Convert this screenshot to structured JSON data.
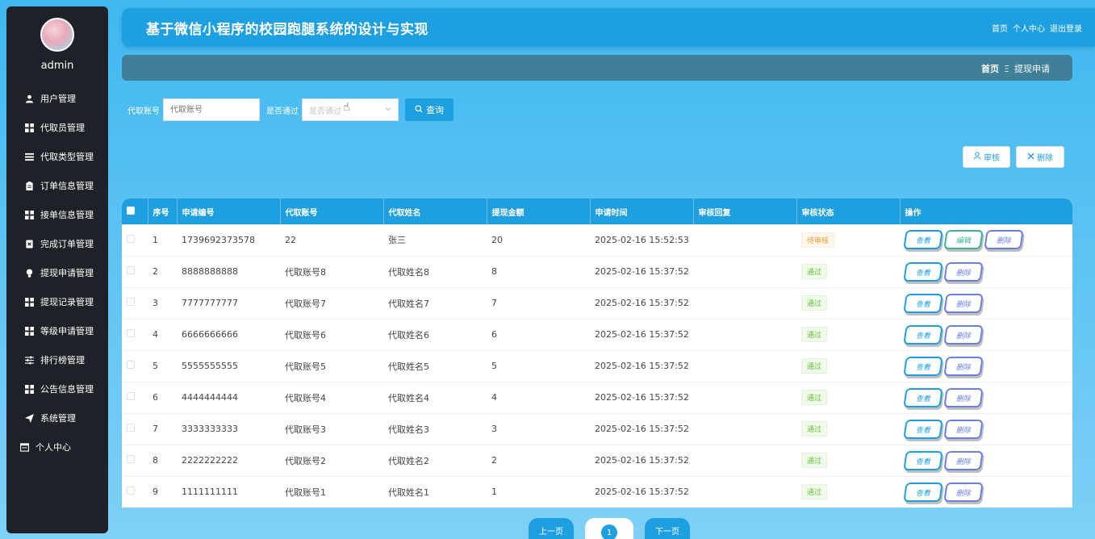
{
  "sidebar": {
    "username": "admin",
    "items": [
      {
        "label": "用户管理",
        "icon": "user-icon"
      },
      {
        "label": "代取员管理",
        "icon": "grid-icon"
      },
      {
        "label": "代取类型管理",
        "icon": "list-icon"
      },
      {
        "label": "订单信息管理",
        "icon": "clipboard-icon"
      },
      {
        "label": "接单信息管理",
        "icon": "grid-icon"
      },
      {
        "label": "完成订单管理",
        "icon": "doc-x-icon"
      },
      {
        "label": "提现申请管理",
        "icon": "bulb-icon"
      },
      {
        "label": "提现记录管理",
        "icon": "grid-icon"
      },
      {
        "label": "等级申请管理",
        "icon": "grid-icon"
      },
      {
        "label": "排行榜管理",
        "icon": "sliders-icon"
      },
      {
        "label": "公告信息管理",
        "icon": "grid-icon"
      },
      {
        "label": "系统管理",
        "icon": "send-icon"
      },
      {
        "label": "个人中心",
        "icon": "window-icon"
      }
    ]
  },
  "header": {
    "title": "基于微信小程序的校园跑腿系统的设计与实现",
    "links": [
      "首页",
      "个人中心",
      "退出登录"
    ]
  },
  "breadcrumb": {
    "home": "首页",
    "separator": "Ξ",
    "current": "提现申请"
  },
  "search": {
    "account_label": "代取账号",
    "account_placeholder": "代取账号",
    "pass_label": "是否通过",
    "pass_placeholder": "是否通过",
    "button_label": "查询"
  },
  "actions": {
    "audit_label": "审核",
    "delete_label": "删除"
  },
  "table": {
    "columns": [
      "序号",
      "申请编号",
      "代取账号",
      "代取姓名",
      "提现金额",
      "申请时间",
      "审核回复",
      "审核状态",
      "操作"
    ],
    "rows": [
      {
        "index": "1",
        "apply_no": "1739692373578",
        "account": "22",
        "name": "张三",
        "amount": "20",
        "time": "2025-02-16 15:52:53",
        "reply": "",
        "status": "待审核",
        "ops": [
          "查看",
          "编辑",
          "删除"
        ]
      },
      {
        "index": "2",
        "apply_no": "8888888888",
        "account": "代取账号8",
        "name": "代取姓名8",
        "amount": "8",
        "time": "2025-02-16 15:37:52",
        "reply": "",
        "status": "通过",
        "ops": [
          "查看",
          "删除"
        ]
      },
      {
        "index": "3",
        "apply_no": "7777777777",
        "account": "代取账号7",
        "name": "代取姓名7",
        "amount": "7",
        "time": "2025-02-16 15:37:52",
        "reply": "",
        "status": "通过",
        "ops": [
          "查看",
          "删除"
        ]
      },
      {
        "index": "4",
        "apply_no": "6666666666",
        "account": "代取账号6",
        "name": "代取姓名6",
        "amount": "6",
        "time": "2025-02-16 15:37:52",
        "reply": "",
        "status": "通过",
        "ops": [
          "查看",
          "删除"
        ]
      },
      {
        "index": "5",
        "apply_no": "5555555555",
        "account": "代取账号5",
        "name": "代取姓名5",
        "amount": "5",
        "time": "2025-02-16 15:37:52",
        "reply": "",
        "status": "通过",
        "ops": [
          "查看",
          "删除"
        ]
      },
      {
        "index": "6",
        "apply_no": "4444444444",
        "account": "代取账号4",
        "name": "代取姓名4",
        "amount": "4",
        "time": "2025-02-16 15:37:52",
        "reply": "",
        "status": "通过",
        "ops": [
          "查看",
          "删除"
        ]
      },
      {
        "index": "7",
        "apply_no": "3333333333",
        "account": "代取账号3",
        "name": "代取姓名3",
        "amount": "3",
        "time": "2025-02-16 15:37:52",
        "reply": "",
        "status": "通过",
        "ops": [
          "查看",
          "删除"
        ]
      },
      {
        "index": "8",
        "apply_no": "2222222222",
        "account": "代取账号2",
        "name": "代取姓名2",
        "amount": "2",
        "time": "2025-02-16 15:37:52",
        "reply": "",
        "status": "通过",
        "ops": [
          "查看",
          "删除"
        ]
      },
      {
        "index": "9",
        "apply_no": "1111111111",
        "account": "代取账号1",
        "name": "代取姓名1",
        "amount": "1",
        "time": "2025-02-16 15:37:52",
        "reply": "",
        "status": "通过",
        "ops": [
          "查看",
          "删除"
        ]
      }
    ]
  },
  "pagination": {
    "prev": "上一页",
    "current": "1",
    "next": "下一页"
  },
  "colors": {
    "primary": "#1e9fe0",
    "sidebar_bg": "#1e2127",
    "breadcrumb_bg": "#3f7f98",
    "pending": "#e6a23c",
    "pass": "#67c23a"
  }
}
